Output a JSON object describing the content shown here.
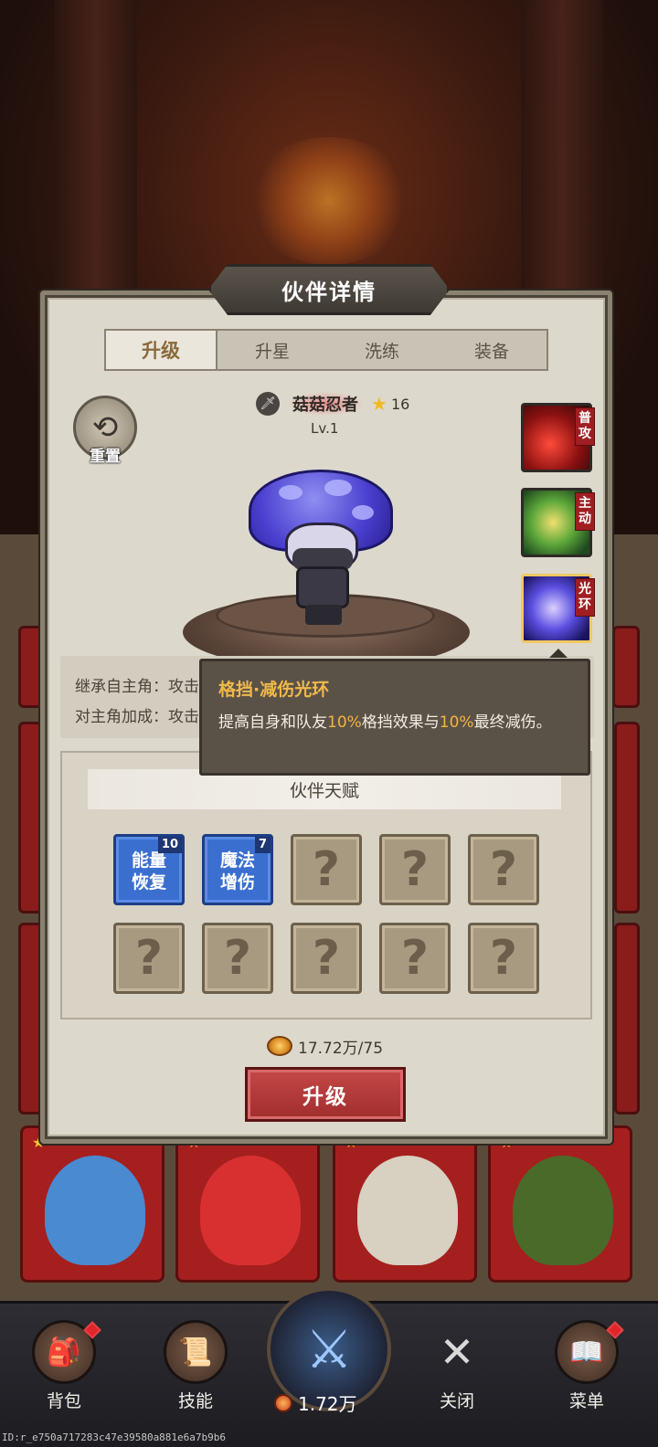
{
  "modal": {
    "title": "伙伴详情",
    "tabs": [
      {
        "label": "升级",
        "active": true
      },
      {
        "label": "升星",
        "active": false
      },
      {
        "label": "洗练",
        "active": false
      },
      {
        "label": "装备",
        "active": false
      }
    ],
    "reset_label": "重置"
  },
  "partner": {
    "name": "菇菇忍者",
    "stars": "16",
    "level": "Lv.1",
    "class_icon": "sword-icon"
  },
  "skills": [
    {
      "tag": "普攻",
      "icon": "claw-slash-icon"
    },
    {
      "tag": "主动",
      "icon": "green-vortex-icon"
    },
    {
      "tag": "光环",
      "icon": "shield-aura-icon"
    }
  ],
  "inherit": {
    "line1": "继承自主角：攻击",
    "line2": "对主角加成：攻击"
  },
  "tooltip": {
    "title": "格挡·减伤光环",
    "desc_a": "提高自身和队友",
    "val1": "10%",
    "desc_b": "格挡效果与",
    "val2": "10%",
    "desc_c": "最终减伤。"
  },
  "talents": {
    "header": "伙伴天赋",
    "active": [
      {
        "line1": "能量",
        "line2": "恢复",
        "level": "10"
      },
      {
        "line1": "魔法",
        "line2": "增伤",
        "level": "7"
      }
    ],
    "locked_symbol": "?"
  },
  "cost": {
    "text": "17.72万/75"
  },
  "upgrade_label": "升级",
  "bottom_nav": {
    "items": [
      {
        "label": "背包",
        "badge": true
      },
      {
        "label": "技能",
        "badge": false
      },
      {
        "label": "关闭",
        "badge": false
      },
      {
        "label": "菜单",
        "badge": true
      }
    ],
    "center_value": "1.72万"
  },
  "footer_id": "ID:r_e750a717283c47e39580a881e6a7b9b6",
  "colors": {
    "accent_red": "#a12d2d",
    "tooltip_highlight": "#f3b540",
    "talent_blue": "#3a6fd0"
  }
}
